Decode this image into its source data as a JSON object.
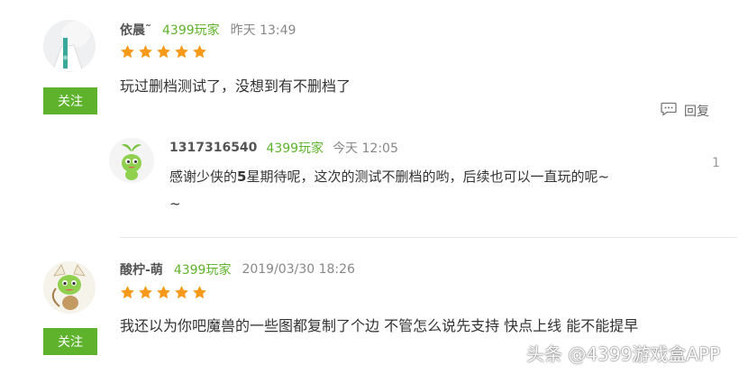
{
  "comments": [
    {
      "username": "依晨˜",
      "badge": "4399玩家",
      "time": "昨天 13:49",
      "rating": 5,
      "text": "玩过删档测试了，没想到有不删档了",
      "follow_label": "关注",
      "reply_label": "回复",
      "avatar_icon": "girl-avatar-icon",
      "reply": {
        "username": "1317316540",
        "badge": "4399玩家",
        "time": "今天 12:05",
        "text_part1": "感谢少侠的",
        "text_bold": "5",
        "text_part2": "星期待呢，这次的测试不删档的哟，后续也可以一直玩的呢~",
        "text_line2": "~",
        "count": "1",
        "avatar_icon": "green-sprout-mascot-icon"
      }
    },
    {
      "username": "酸柠-萌",
      "badge": "4399玩家",
      "time": "2019/03/30 18:26",
      "rating": 5,
      "text": "我还以为你吧魔兽的一些图都复制了个边 不管怎么说先支持 快点上线 能不能提早",
      "follow_label": "关注",
      "avatar_icon": "mascot-archer-avatar-icon"
    }
  ],
  "watermark": "头条 @4399游戏盒APP",
  "colors": {
    "accent": "#5fb32c",
    "star": "#f79a1b"
  }
}
